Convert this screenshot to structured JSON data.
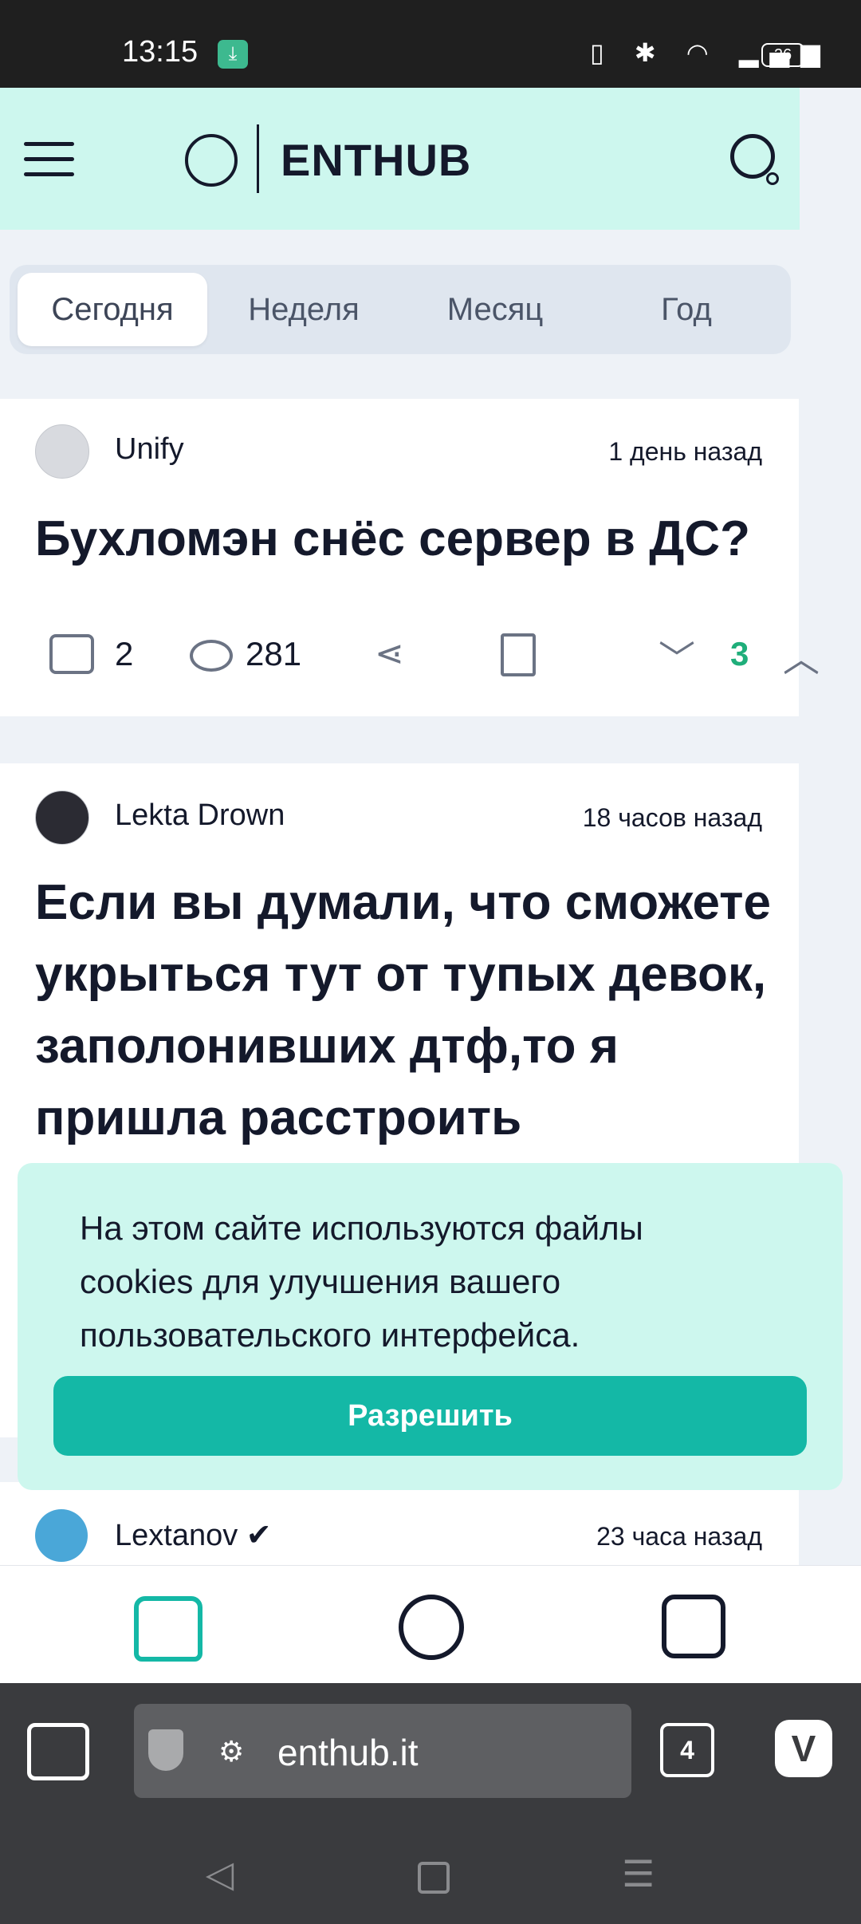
{
  "status_bar": {
    "time": "13:15",
    "battery": "26"
  },
  "header": {
    "logo_text": "ENTHUB"
  },
  "tabs": [
    "Сегодня",
    "Неделя",
    "Месяц",
    "Год"
  ],
  "posts": [
    {
      "author": "Unify",
      "time": "1 день назад",
      "title": "Бухломэн снёс сервер в ДС?",
      "comments": "2",
      "views": "281",
      "rating": "3"
    },
    {
      "author": "Lekta Drown",
      "time": "18 часов назад",
      "title": "Если вы думали, что сможете укрыться тут от тупых девок, заполонивших дтф,то я пришла расстроить"
    },
    {
      "author": "Lextanov ✔",
      "time": "23 часа назад"
    }
  ],
  "cookie": {
    "text": "На этом сайте используются файлы cookies для улучшения вашего пользовательского интерфейса.",
    "button": "Разрешить"
  },
  "browser": {
    "url": "enthub.it",
    "tabs_count": "4"
  },
  "colors": {
    "accent": "#14b8a6",
    "header_bg": "#cdf7ee",
    "rating": "#1fae7a"
  }
}
